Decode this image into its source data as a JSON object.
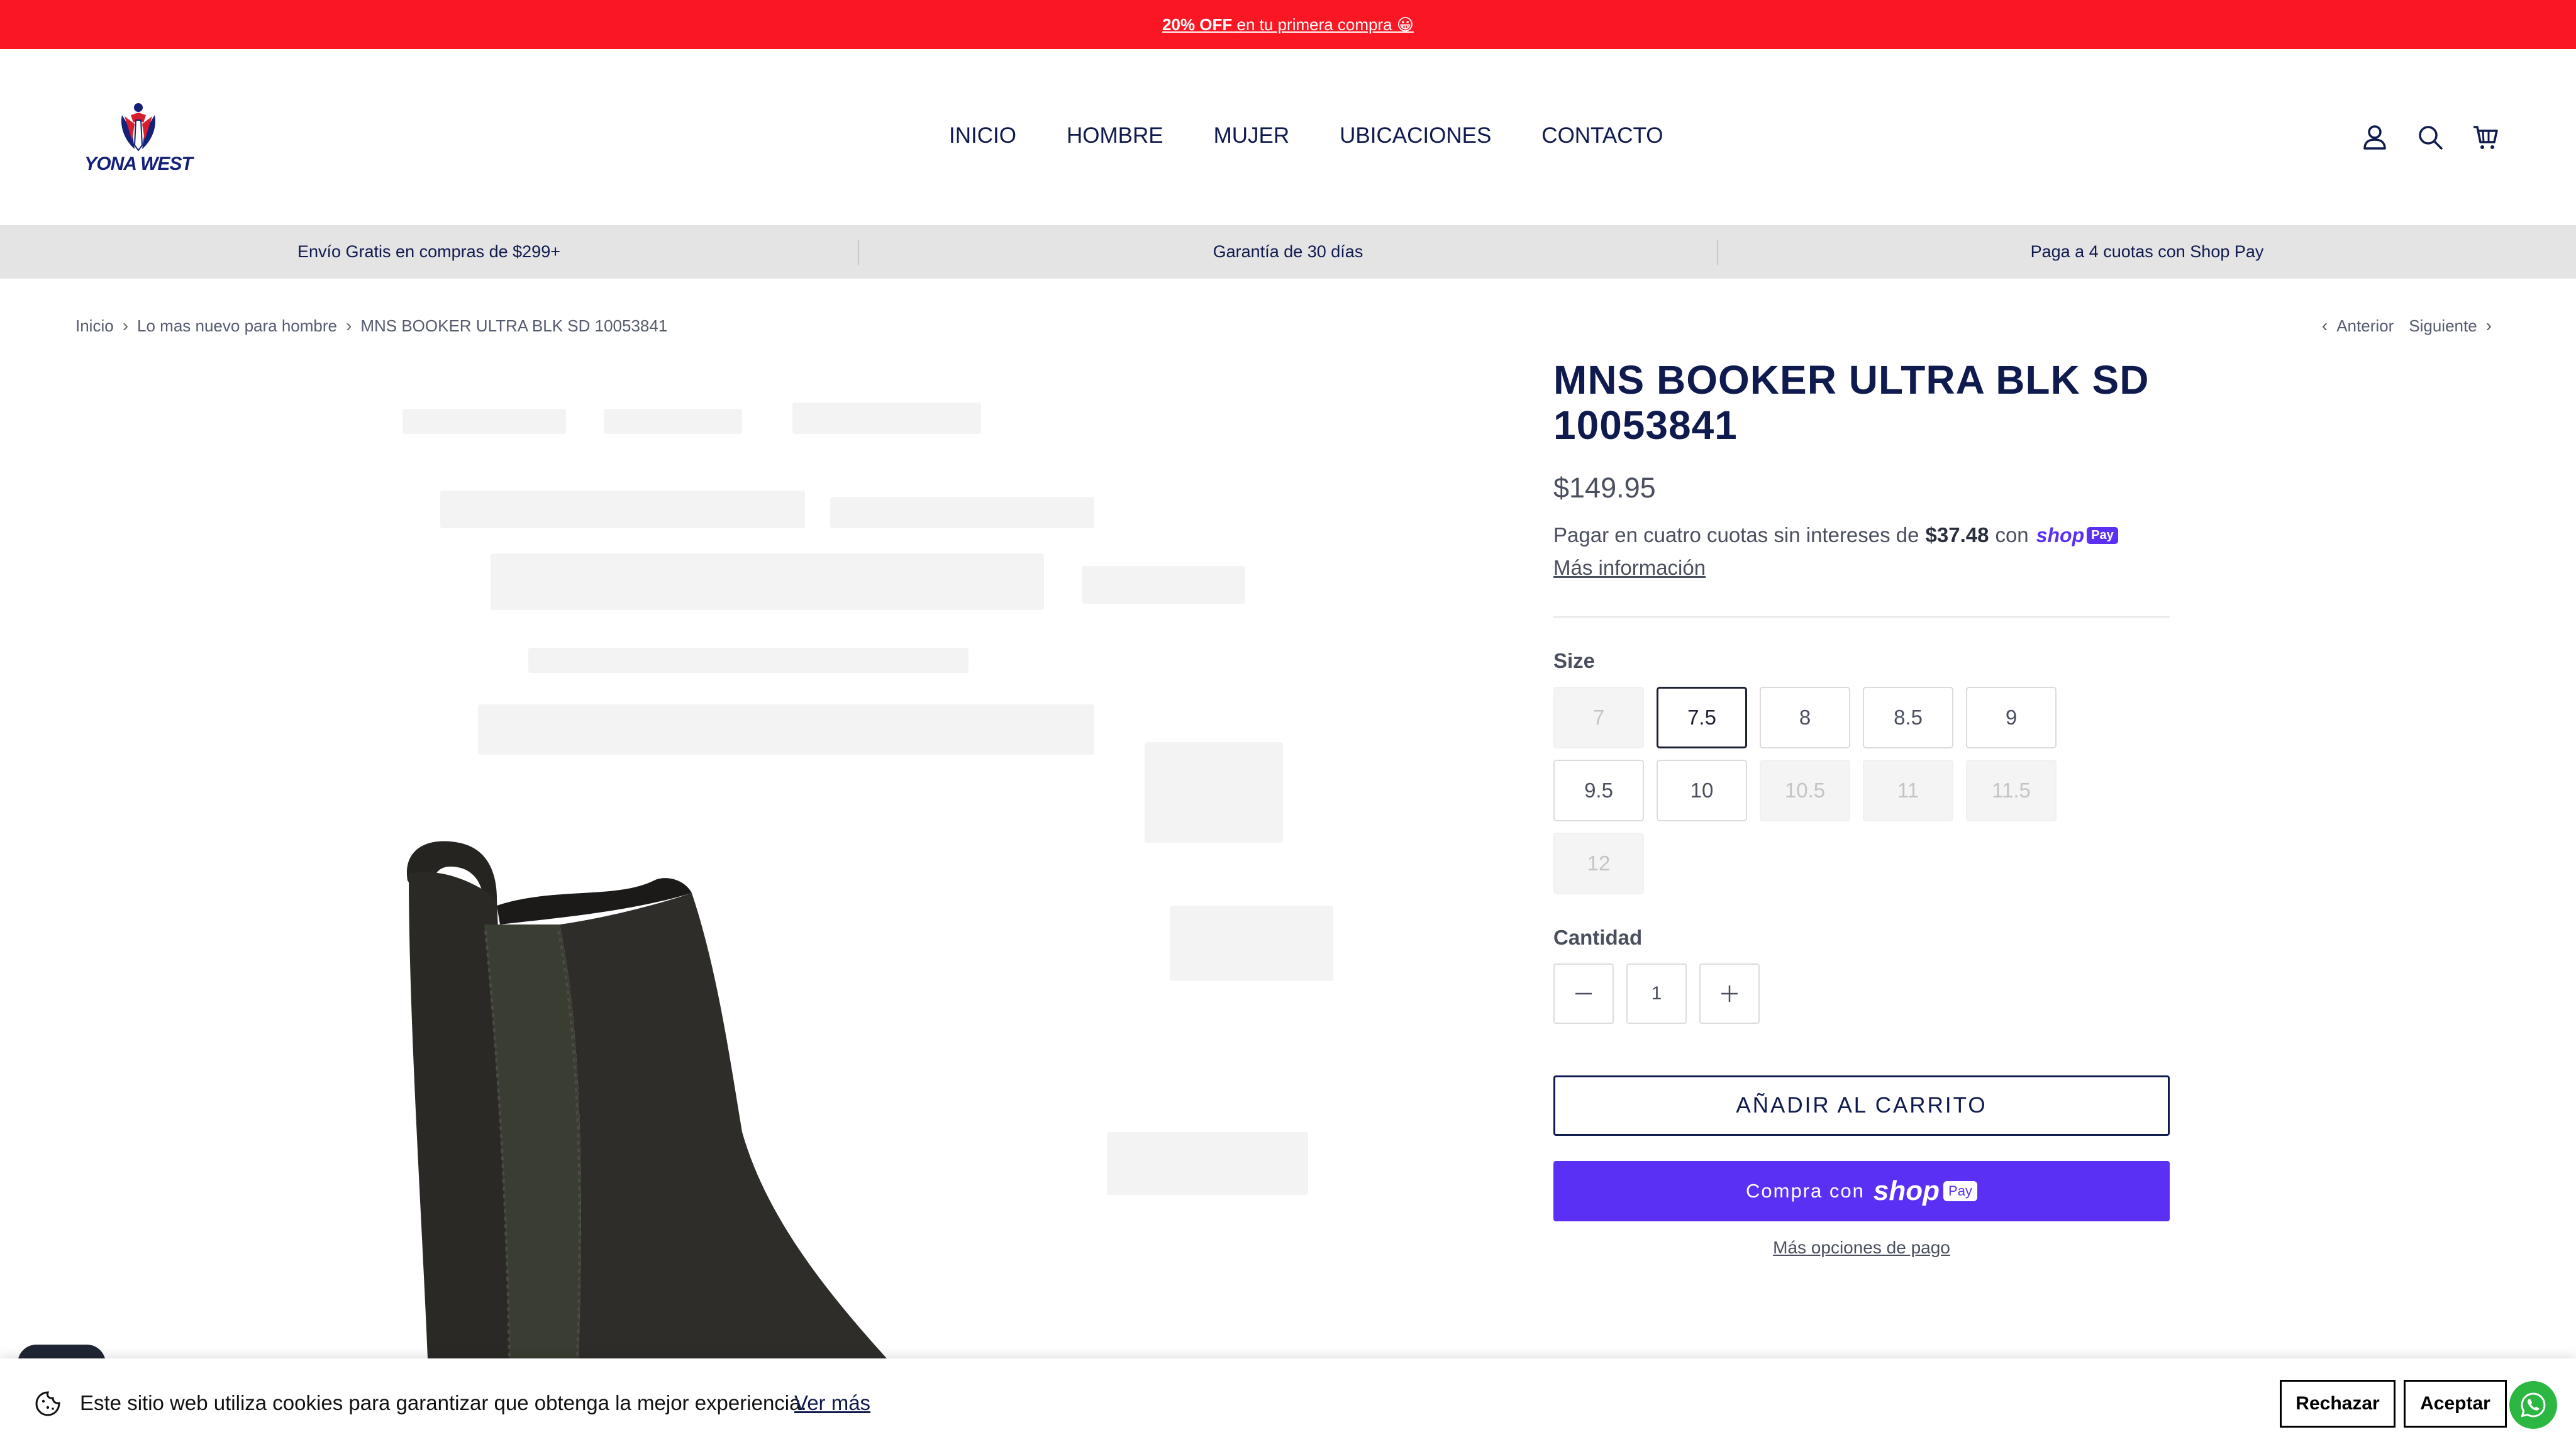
{
  "announcement": {
    "highlight": "20% OFF",
    "text": " en tu primera compra 😀"
  },
  "brand": {
    "logo_text": "YONA WEST"
  },
  "nav": [
    "INICIO",
    "HOMBRE",
    "MUJER",
    "UBICACIONES",
    "CONTACTO"
  ],
  "header_icons": [
    "account-icon",
    "search-icon",
    "cart-icon"
  ],
  "usp": [
    "Envío Gratis en compras de $299+",
    "Garantía de 30 días",
    "Paga a 4 cuotas con Shop Pay"
  ],
  "breadcrumb": [
    "Inicio",
    "Lo mas nuevo para hombre",
    "MNS BOOKER ULTRA BLK SD 10053841"
  ],
  "pager": {
    "prev": "Anterior",
    "next": "Siguiente"
  },
  "product": {
    "title": "MNS BOOKER ULTRA BLK SD 10053841",
    "price": "$149.95",
    "installments_prefix": "Pagar en cuatro cuotas sin intereses de",
    "installment_amount": "$37.48",
    "installments_suffix": "con",
    "shoppay_brand": "shop",
    "shoppay_badge": "Pay",
    "more_info": "Más información",
    "size_label": "Size",
    "sizes": [
      {
        "label": "7",
        "available": false,
        "selected": false
      },
      {
        "label": "7.5",
        "available": true,
        "selected": true
      },
      {
        "label": "8",
        "available": true,
        "selected": false
      },
      {
        "label": "8.5",
        "available": true,
        "selected": false
      },
      {
        "label": "9",
        "available": true,
        "selected": false
      },
      {
        "label": "9.5",
        "available": true,
        "selected": false
      },
      {
        "label": "10",
        "available": true,
        "selected": false
      },
      {
        "label": "10.5",
        "available": false,
        "selected": false
      },
      {
        "label": "11",
        "available": false,
        "selected": false
      },
      {
        "label": "11.5",
        "available": false,
        "selected": false
      },
      {
        "label": "12",
        "available": false,
        "selected": false
      }
    ],
    "quantity_label": "Cantidad",
    "quantity": "1",
    "add_to_cart": "AÑADIR AL CARRITO",
    "buy_with": "Compra con",
    "more_payment": "Más opciones de pago"
  },
  "cookie": {
    "text": "Este sitio web utiliza cookies para garantizar que obtenga la mejor experiencia.",
    "link": "Ver más",
    "reject": "Rechazar",
    "accept": "Aceptar"
  },
  "colors": {
    "announcement": "#fa1723",
    "navy": "#0f1a4e",
    "shoppay": "#5a31f4",
    "whatsapp": "#2cb742"
  }
}
